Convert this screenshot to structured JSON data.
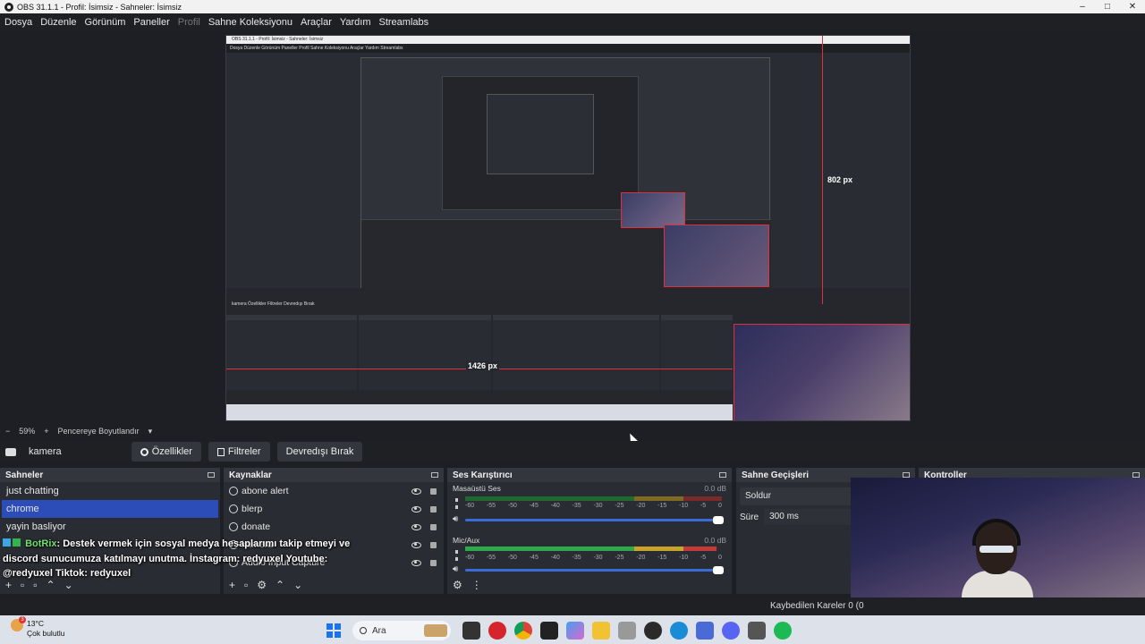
{
  "window": {
    "title": "OBS 31.1.1 - Profil: İsimsiz - Sahneler: İsimsiz",
    "controls": [
      "–",
      "□",
      "✕"
    ]
  },
  "menu": [
    {
      "label": "Dosya",
      "disabled": false
    },
    {
      "label": "Düzenle",
      "disabled": false
    },
    {
      "label": "Görünüm",
      "disabled": false
    },
    {
      "label": "Paneller",
      "disabled": false
    },
    {
      "label": "Profil",
      "disabled": true
    },
    {
      "label": "Sahne Koleksiyonu",
      "disabled": false
    },
    {
      "label": "Araçlar",
      "disabled": false
    },
    {
      "label": "Yardım",
      "disabled": false
    },
    {
      "label": "Streamlabs",
      "disabled": false
    }
  ],
  "preview": {
    "nested_title": "OBS 31.1.1 - Profil: İsimsiz - Sahneler: İsimsiz",
    "nested_menu": "Dosya   Düzenle   Görünüm   Paneller   Profil   Sahne Koleksiyonu   Araçlar   Yardım   Streamlabs",
    "nested_toolbar": "kamera        Özellikler     Filtreler     Devredışı Bırak",
    "height_label": "802 px",
    "width_label": "1426 px"
  },
  "zoom": {
    "minus": "−",
    "value": "59%",
    "plus": "+",
    "mode": "Pencereye Boyutlandır",
    "caret": "▾"
  },
  "source_toolbar": {
    "selected_source": "kamera",
    "properties": "Özellikler",
    "filters": "Filtreler",
    "deactivate": "Devredışı Bırak"
  },
  "scenes": {
    "title": "Sahneler",
    "items": [
      "just chatting",
      "chrome",
      "yayin basliyor"
    ],
    "active_index": 1
  },
  "sources": {
    "title": "Kaynaklar",
    "items": [
      "abone alert",
      "blerp",
      "donate",
      "kamera",
      "Audio Input Capture"
    ]
  },
  "mixer": {
    "title": "Ses Karıştırıcı",
    "channels": [
      {
        "name": "Masaüstü Ses",
        "db": "0.0 dB",
        "level": 0.0
      },
      {
        "name": "Mic/Aux",
        "db": "0.0 dB",
        "level": 0.97
      }
    ],
    "ticks": [
      "-60",
      "-55",
      "-50",
      "-45",
      "-40",
      "-35",
      "-30",
      "-25",
      "-20",
      "-15",
      "-10",
      "-5",
      "0"
    ]
  },
  "transitions": {
    "title": "Sahne Geçişleri",
    "selected": "Soldur",
    "duration_label": "Süre",
    "duration_value": "300 ms"
  },
  "controls": {
    "title": "Kontroller"
  },
  "chat": {
    "bot_name": "BotRix",
    "message": ": Destek vermek için sosyal medya hesaplarımı takip etmeyi ve discord sunucumuza katılmayı unutma. İnstagram: redyuxel Youtube: @redyuxel Tiktok: redyuxel"
  },
  "status": {
    "dropped_frames": "Kaybedilen Kareler 0 (0"
  },
  "taskbar": {
    "temp": "13°C",
    "weather": "Çok bulutlu",
    "search_placeholder": "Ara"
  },
  "colors": {
    "accent": "#2c4cb8",
    "red_guide": "#e03040",
    "meter_green": "#2ea84a",
    "meter_yellow": "#c9a32a",
    "meter_red": "#c43a3a"
  }
}
